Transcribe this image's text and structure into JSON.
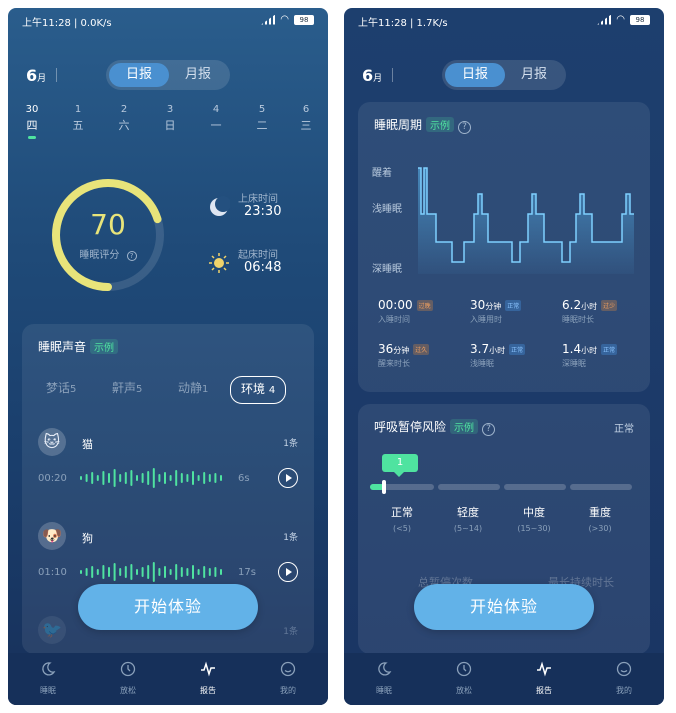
{
  "status": {
    "time": "上午11:28 | 0.0K/s",
    "time_right": "上午11:28 | 1.7K/s",
    "battery": "98"
  },
  "header": {
    "month_num": "6",
    "month_unit": "月",
    "tab_day": "日报",
    "tab_month": "月报"
  },
  "days": [
    {
      "n": "30",
      "w": "四",
      "active": true
    },
    {
      "n": "1",
      "w": "五"
    },
    {
      "n": "2",
      "w": "六"
    },
    {
      "n": "3",
      "w": "日"
    },
    {
      "n": "4",
      "w": "一"
    },
    {
      "n": "5",
      "w": "二"
    },
    {
      "n": "6",
      "w": "三"
    }
  ],
  "score": {
    "value": "70",
    "label": "睡眠评分",
    "progress": 0.7
  },
  "bedtime": {
    "label": "上床时间",
    "value": "23:30"
  },
  "waketime": {
    "label": "起床时间",
    "value": "06:48"
  },
  "sounds": {
    "title": "睡眠声音",
    "example": "示例",
    "tabs": [
      {
        "label": "梦话",
        "count": "5"
      },
      {
        "label": "鼾声",
        "count": "5"
      },
      {
        "label": "动静",
        "count": "1"
      },
      {
        "label": "环境",
        "count": "4",
        "active": true
      }
    ],
    "items": [
      {
        "name": "猫",
        "count": "1条",
        "start": "00:20",
        "duration": "6s",
        "icon": "🐱"
      },
      {
        "name": "狗",
        "count": "1条",
        "start": "01:10",
        "duration": "17s",
        "icon": "🐶"
      },
      {
        "name": "",
        "count": "1条",
        "icon": "🐦"
      }
    ]
  },
  "cta": {
    "label": "开始体验"
  },
  "nav": [
    {
      "label": "睡眠",
      "icon": "moon-icon"
    },
    {
      "label": "放松",
      "icon": "relax-icon"
    },
    {
      "label": "报告",
      "icon": "pulse-icon",
      "active": true
    },
    {
      "label": "我的",
      "icon": "profile-icon"
    }
  ],
  "cycle": {
    "title": "睡眠周期",
    "example": "示例",
    "levels": [
      "醒着",
      "浅睡眠",
      "深睡眠"
    ],
    "stats": [
      {
        "value": "00:00",
        "unit": "",
        "label": "入睡时间",
        "badge": "过晚",
        "kind": "warn"
      },
      {
        "value": "30",
        "unit": "分钟",
        "label": "入睡用时",
        "badge": "正常",
        "kind": "ok"
      },
      {
        "value": "6.2",
        "unit": "小时",
        "label": "睡眠时长",
        "badge": "过少",
        "kind": "warn"
      },
      {
        "value": "36",
        "unit": "分钟",
        "label": "醒来时长",
        "badge": "过久",
        "kind": "warn"
      },
      {
        "value": "3.7",
        "unit": "小时",
        "label": "浅睡眠",
        "badge": "正常",
        "kind": "ok"
      },
      {
        "value": "1.4",
        "unit": "小时",
        "label": "深睡眠",
        "badge": "正常",
        "kind": "ok"
      }
    ]
  },
  "apnea": {
    "title": "呼吸暂停风险",
    "example": "示例",
    "status": "正常",
    "tip": "1",
    "levels": [
      {
        "name": "正常",
        "range": "(<5)"
      },
      {
        "name": "轻度",
        "range": "(5~14)"
      },
      {
        "name": "中度",
        "range": "(15~30)"
      },
      {
        "name": "重度",
        "range": "(>30)"
      }
    ],
    "ghost_left": "总暂停次数",
    "ghost_right": "最长持续时长"
  },
  "colors": {
    "accent": "#4fe3a0",
    "ring": "#e8e47a",
    "button": "#62b2e8"
  }
}
